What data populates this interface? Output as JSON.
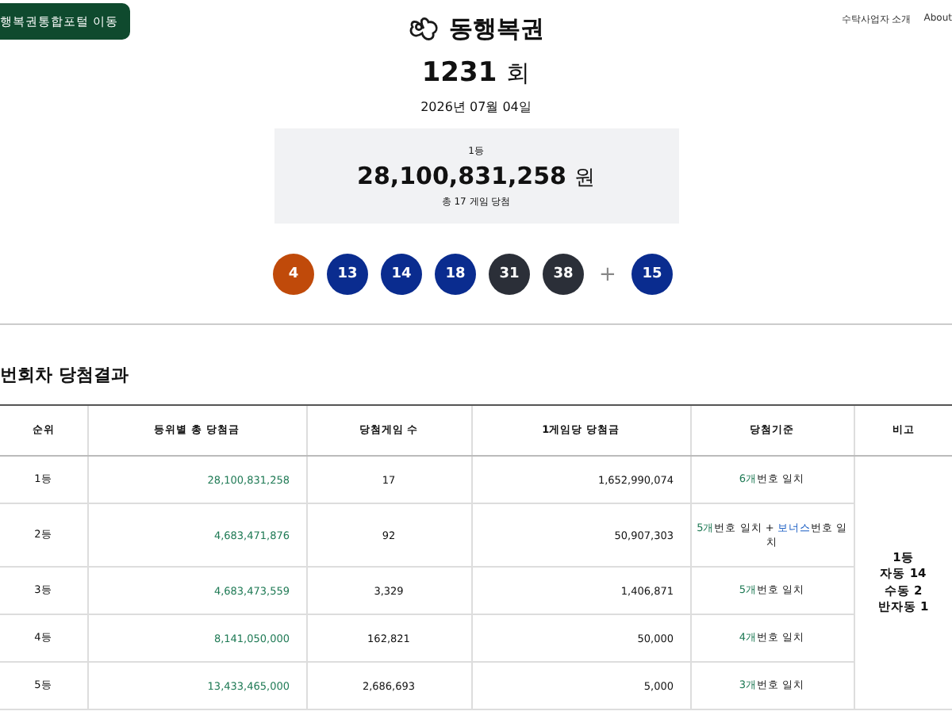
{
  "header": {
    "portal_button": "행복권통합포털 이동",
    "logo_text": "동행복권",
    "nav_links": [
      "수탁사업자 소개",
      "About"
    ]
  },
  "draw": {
    "round": "1231",
    "round_unit": "회",
    "date": "2026년 07월 04일"
  },
  "prize_box": {
    "rank": "1등",
    "amount": "28,100,831,258",
    "unit": "원",
    "winners": "총 17 게임 당첨"
  },
  "balls": [
    {
      "number": "4",
      "color": "#c04a0a"
    },
    {
      "number": "13",
      "color": "#0a2c8f"
    },
    {
      "number": "14",
      "color": "#0a2c8f"
    },
    {
      "number": "18",
      "color": "#0a2c8f"
    },
    {
      "number": "31",
      "color": "#2b2f38"
    },
    {
      "number": "38",
      "color": "#2b2f38"
    }
  ],
  "plus": "+",
  "bonus_ball": {
    "number": "15",
    "color": "#0a2c8f"
  },
  "section_title": "번회차 당첨결과",
  "table": {
    "columns": [
      "순위",
      "등위별 총 당첨금",
      "당첨게임 수",
      "1게임당 당첨금",
      "당첨기준",
      "비고"
    ],
    "rows": [
      {
        "rank": "1등",
        "total": "28,100,831,258",
        "games": "17",
        "per_game": "1,652,990,074",
        "criteria": [
          {
            "kind": "count",
            "text": "6개"
          },
          {
            "kind": "plain",
            "text": "번호 일치"
          }
        ]
      },
      {
        "rank": "2등",
        "total": "4,683,471,876",
        "games": "92",
        "per_game": "50,907,303",
        "criteria": [
          {
            "kind": "count",
            "text": "5개"
          },
          {
            "kind": "plain",
            "text": "번호 일치 + "
          },
          {
            "kind": "bonus",
            "text": "보너스"
          },
          {
            "kind": "plain",
            "text": "번호 일치"
          }
        ]
      },
      {
        "rank": "3등",
        "total": "4,683,473,559",
        "games": "3,329",
        "per_game": "1,406,871",
        "criteria": [
          {
            "kind": "count",
            "text": "5개"
          },
          {
            "kind": "plain",
            "text": "번호 일치"
          }
        ]
      },
      {
        "rank": "4등",
        "total": "8,141,050,000",
        "games": "162,821",
        "per_game": "50,000",
        "criteria": [
          {
            "kind": "count",
            "text": "4개"
          },
          {
            "kind": "plain",
            "text": "번호 일치"
          }
        ]
      },
      {
        "rank": "5등",
        "total": "13,433,465,000",
        "games": "2,686,693",
        "per_game": "5,000",
        "criteria": [
          {
            "kind": "count",
            "text": "3개"
          },
          {
            "kind": "plain",
            "text": "번호 일치"
          }
        ]
      }
    ],
    "note": [
      "1등",
      "자동 14",
      "수동 2",
      "반자동 1"
    ]
  }
}
